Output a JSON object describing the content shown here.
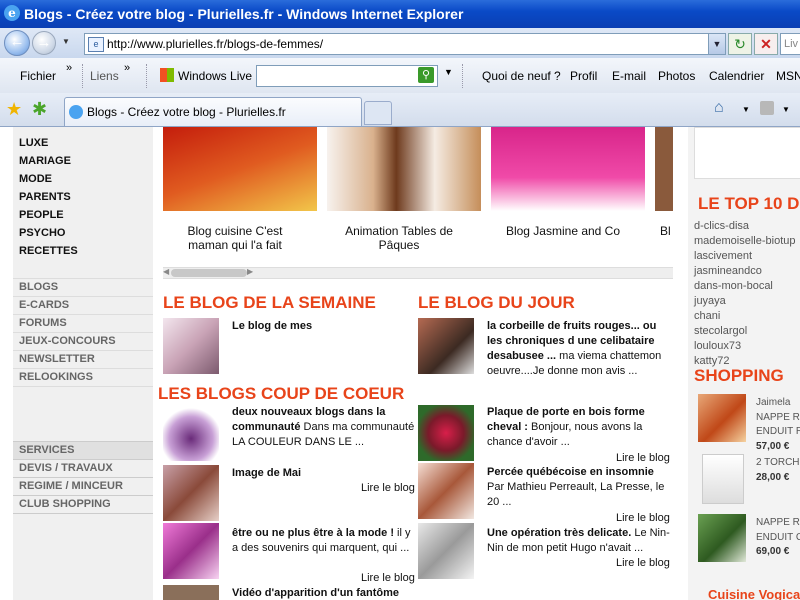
{
  "window": {
    "title": "Blogs - Créez votre blog - Plurielles.fr - Windows Internet Explorer"
  },
  "address": {
    "url": "http://www.plurielles.fr/blogs-de-femmes/",
    "live_search": "Liv"
  },
  "links_toolbar": {
    "fichier": "Fichier",
    "liens": "Liens",
    "windows_live": "Windows Live",
    "items": [
      "Quoi de neuf ?",
      "Profil",
      "E-mail",
      "Photos",
      "Calendrier",
      "MSN"
    ]
  },
  "tab": {
    "label": "Blogs - Créez votre blog - Plurielles.fr"
  },
  "left_nav": {
    "categories": [
      "LUXE",
      "MARIAGE",
      "MODE",
      "PARENTS",
      "PEOPLE",
      "PSYCHO",
      "RECETTES"
    ],
    "links": [
      "BLOGS",
      "E-CARDS",
      "FORUMS",
      "JEUX-CONCOURS",
      "NEWSLETTER",
      "RELOOKINGS"
    ],
    "services": [
      "SERVICES",
      "DEVIS / TRAVAUX",
      "REGIME / MINCEUR",
      "CLUB SHOPPING"
    ]
  },
  "carousel": {
    "captions": [
      "Blog cuisine C'est maman qui l'a fait",
      "Animation Tables de Pâques",
      "Blog Jasmine and Co",
      "Bl"
    ]
  },
  "sections": {
    "semaine": "LE BLOG DE LA SEMAINE",
    "jour": "LE BLOG DU JOUR",
    "coup": "LES BLOGS COUP DE COEUR"
  },
  "blog_semaine": {
    "title": "Le blog de mes"
  },
  "blog_jour": {
    "title": "la corbeille de fruits rouges... ou les chroniques d une celibataire desabusee ...",
    "text": " ma viema chattemon oeuvre....Je donne mon avis ..."
  },
  "coup_left": [
    {
      "title": "deux nouveaux blogs dans la communauté",
      "text": " Dans ma communauté LA COULEUR DANS LE ...",
      "lire": ""
    },
    {
      "title": "Image de Mai",
      "text": "",
      "lire": "Lire le blog"
    },
    {
      "title": "être ou ne plus être à la mode !",
      "text": " il y a des souvenirs qui marquent, qui ...",
      "lire": "Lire le blog"
    },
    {
      "title": "Vidéo d'apparition d'un fantôme",
      "text": "",
      "lire": ""
    }
  ],
  "coup_right": [
    {
      "title": "Plaque de porte en bois forme cheval :",
      "text": " Bonjour, nous avons la chance d'avoir ...",
      "lire": "Lire le blog"
    },
    {
      "title": "Percée québécoise en insomnie",
      "text": " Par Mathieu Perreault, La Presse, le 20 ...",
      "lire": "Lire le blog"
    },
    {
      "title": "Une opération très delicate.",
      "text": " Le Nin-Nin de mon petit Hugo n'avait ...",
      "lire": "Lire le blog"
    }
  ],
  "right": {
    "top10_title": "LE TOP 10 D",
    "top10": [
      "d-clics-disa",
      "mademoiselle-biotup",
      "lascivement",
      "jasmineandco",
      "dans-mon-bocal",
      "juyaya",
      "chani",
      "stecolargol",
      "louloux73",
      "katty72"
    ],
    "shopping_title": "SHOPPING",
    "shop": [
      {
        "name": "Jaimela",
        "line2": "NAPPE R",
        "line3": "ENDUIT R",
        "price": "57,00 €"
      },
      {
        "name": "2 TORCH",
        "line2": "",
        "line3": "",
        "price": "28,00 €"
      },
      {
        "name": "NAPPE R",
        "line2": "ENDUIT C",
        "line3": "",
        "price": "69,00 €"
      }
    ],
    "cuisine": "Cuisine Vogica"
  },
  "colors": {
    "accent": "#e8441a",
    "titlebar": "#0a4ac7"
  }
}
